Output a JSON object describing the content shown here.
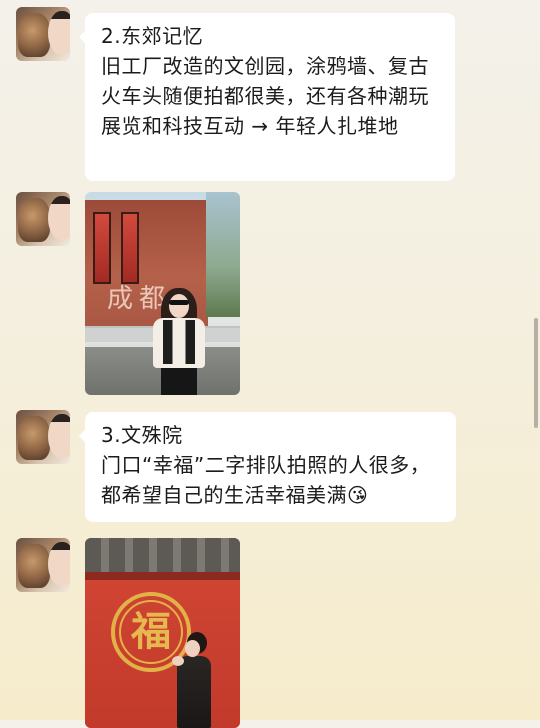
{
  "messages": [
    {
      "type": "text",
      "title": "2.东郊记忆",
      "body": "旧工厂改造的文创园，涂鸦墙、复古火车头随便拍都很美，还有各种潮玩展览和科技互动 → 年轻人扎堆地"
    },
    {
      "type": "image",
      "sign_text": "成都"
    },
    {
      "type": "text",
      "title": "3.文殊院",
      "body": "门口“幸福”二字排队拍照的人很多，都希望自己的生活幸福美满",
      "emoji": "😘"
    },
    {
      "type": "image",
      "wall_text": "福"
    }
  ],
  "colors": {
    "bubble": "#ffffff",
    "text": "#1b1b1b",
    "background_top": "#f3f1ea",
    "background_bottom": "#f6eccc"
  },
  "icons": {
    "avatar": "avatar-cat-and-person-icon",
    "emoji": "blowing-kiss-emoji-icon"
  }
}
